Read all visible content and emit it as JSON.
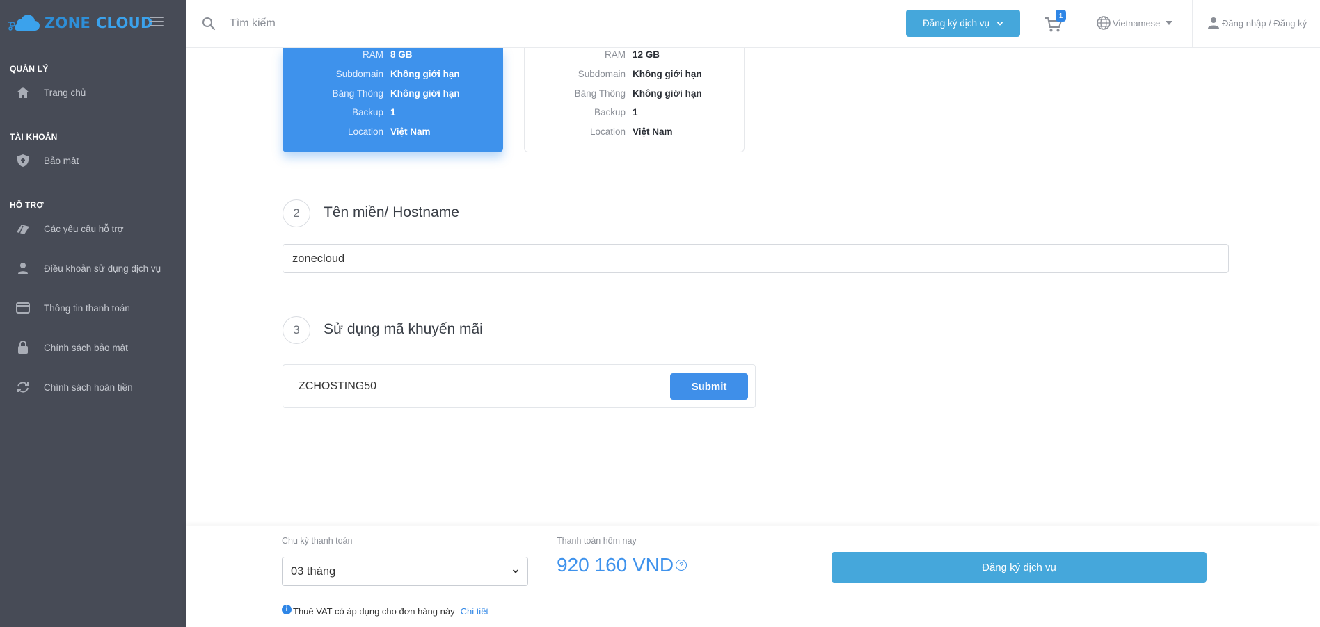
{
  "brand": {
    "logo_part1": "ZONE",
    "logo_part2": "CLOUD",
    "colors": {
      "primary": "#3ba2ec",
      "sidebar_bg": "#474b56",
      "button": "#45a7db",
      "card_active": "#3e92ec"
    }
  },
  "sidebar": {
    "sections": [
      {
        "title": "QUẢN LÝ",
        "items": [
          {
            "label": "Trang chủ",
            "icon": "home-icon"
          }
        ]
      },
      {
        "title": "TÀI KHOẢN",
        "items": [
          {
            "label": "Bảo mật",
            "icon": "shield-icon"
          }
        ]
      },
      {
        "title": "HỖ TRỢ",
        "items": [
          {
            "label": "Các yêu cầu hỗ trợ",
            "icon": "tickets-icon"
          },
          {
            "label": "Điều khoản sử dụng dịch vụ",
            "icon": "person-icon"
          },
          {
            "label": "Thông tin thanh toán",
            "icon": "credit-card-icon"
          },
          {
            "label": "Chính sách bảo mật",
            "icon": "lock-icon"
          },
          {
            "label": "Chính sách hoàn tiền",
            "icon": "refresh-icon"
          }
        ]
      }
    ]
  },
  "header": {
    "search_placeholder": "Tìm kiếm",
    "register_button": "Đăng ký dịch vụ",
    "cart_count": "1",
    "language": "Vietnamese",
    "login": "Đăng nhập / Đăng ký"
  },
  "plans": [
    {
      "selected": true,
      "specs": [
        {
          "key": "RAM",
          "value": "8 GB"
        },
        {
          "key": "Subdomain",
          "value": "Không giới hạn"
        },
        {
          "key": "Băng Thông",
          "value": "Không giới hạn"
        },
        {
          "key": "Backup",
          "value": "1"
        },
        {
          "key": "Location",
          "value": "Việt Nam"
        }
      ]
    },
    {
      "selected": false,
      "specs": [
        {
          "key": "RAM",
          "value": "12 GB"
        },
        {
          "key": "Subdomain",
          "value": "Không giới hạn"
        },
        {
          "key": "Băng Thông",
          "value": "Không giới hạn"
        },
        {
          "key": "Backup",
          "value": "1"
        },
        {
          "key": "Location",
          "value": "Việt Nam"
        }
      ]
    }
  ],
  "steps": [
    {
      "number": "2",
      "title": "Tên miền/ Hostname",
      "input_value": "zonecloud"
    },
    {
      "number": "3",
      "title": "Sử dụng mã khuyến mãi",
      "input_value": "ZCHOSTING50",
      "button": "Submit"
    }
  ],
  "footer": {
    "cycle_label": "Chu kỳ thanh toán",
    "cycle_value": "03 tháng",
    "today_label": "Thanh toán hôm nay",
    "amount": "920 160 VND",
    "help_glyph": "?",
    "register_button": "Đăng ký dịch vụ",
    "vat_icon_glyph": "i",
    "vat_text": "Thuế VAT có áp dụng cho đơn hàng này",
    "vat_link": "Chi tiết"
  }
}
